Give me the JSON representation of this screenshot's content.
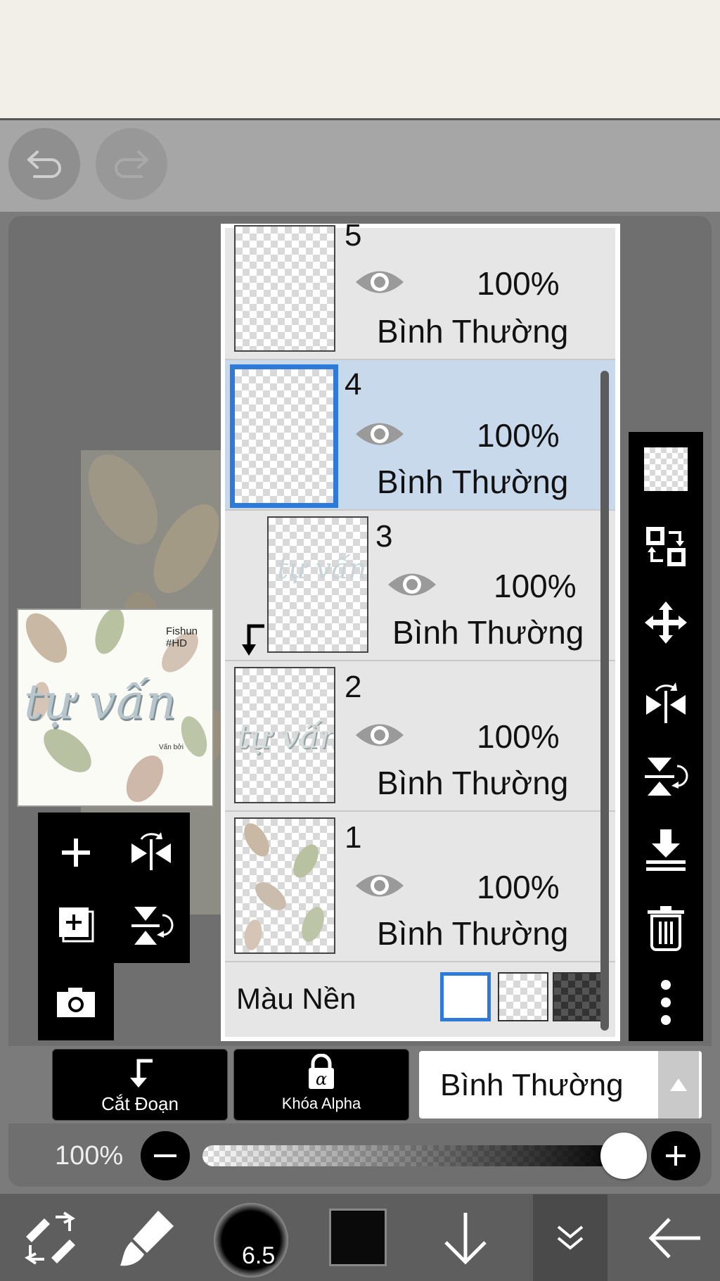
{
  "layers": [
    {
      "number": "5",
      "opacity": "100%",
      "blend_mode": "Bình Thường"
    },
    {
      "number": "4",
      "opacity": "100%",
      "blend_mode": "Bình Thường",
      "selected": true
    },
    {
      "number": "3",
      "opacity": "100%",
      "blend_mode": "Bình Thường",
      "clipped": true
    },
    {
      "number": "2",
      "opacity": "100%",
      "blend_mode": "Bình Thường"
    },
    {
      "number": "1",
      "opacity": "100%",
      "blend_mode": "Bình Thường"
    }
  ],
  "background": {
    "label": "Màu Nền"
  },
  "actions": {
    "clipping_label": "Cắt Đoạn",
    "alpha_lock_label": "Khóa Alpha"
  },
  "blend_select": {
    "value": "Bình Thường"
  },
  "opacity_slider": {
    "label": "100%",
    "value": 1.0
  },
  "brush": {
    "size_label": "6.5"
  },
  "preview": {
    "text_main": "tự vấn",
    "text_sign": "Fishun #HD",
    "text_small": "Vấn bởi"
  },
  "colors": {
    "accent": "#2e7ad8",
    "selected_row": "#c8d9ec",
    "toolbar": "#000000",
    "foreground_color": "#0a0a0a"
  },
  "icons": {
    "undo": "undo-icon",
    "redo": "redo-icon",
    "right_tools": [
      "checker-icon",
      "move-layer-icon",
      "move-icon",
      "flip-horizontal-icon",
      "flip-vertical-icon",
      "merge-down-icon",
      "trash-icon",
      "more-icon"
    ],
    "left_tools": [
      "add-layer-icon",
      "flip-horizontal-icon",
      "add-copy-icon",
      "flip-vertical-icon",
      "camera-icon"
    ],
    "bottom": [
      "transform-icon",
      "brush-icon",
      "brush-size-icon",
      "color-swatch-icon",
      "arrow-down-icon",
      "layers-toggle-icon",
      "back-icon"
    ]
  }
}
